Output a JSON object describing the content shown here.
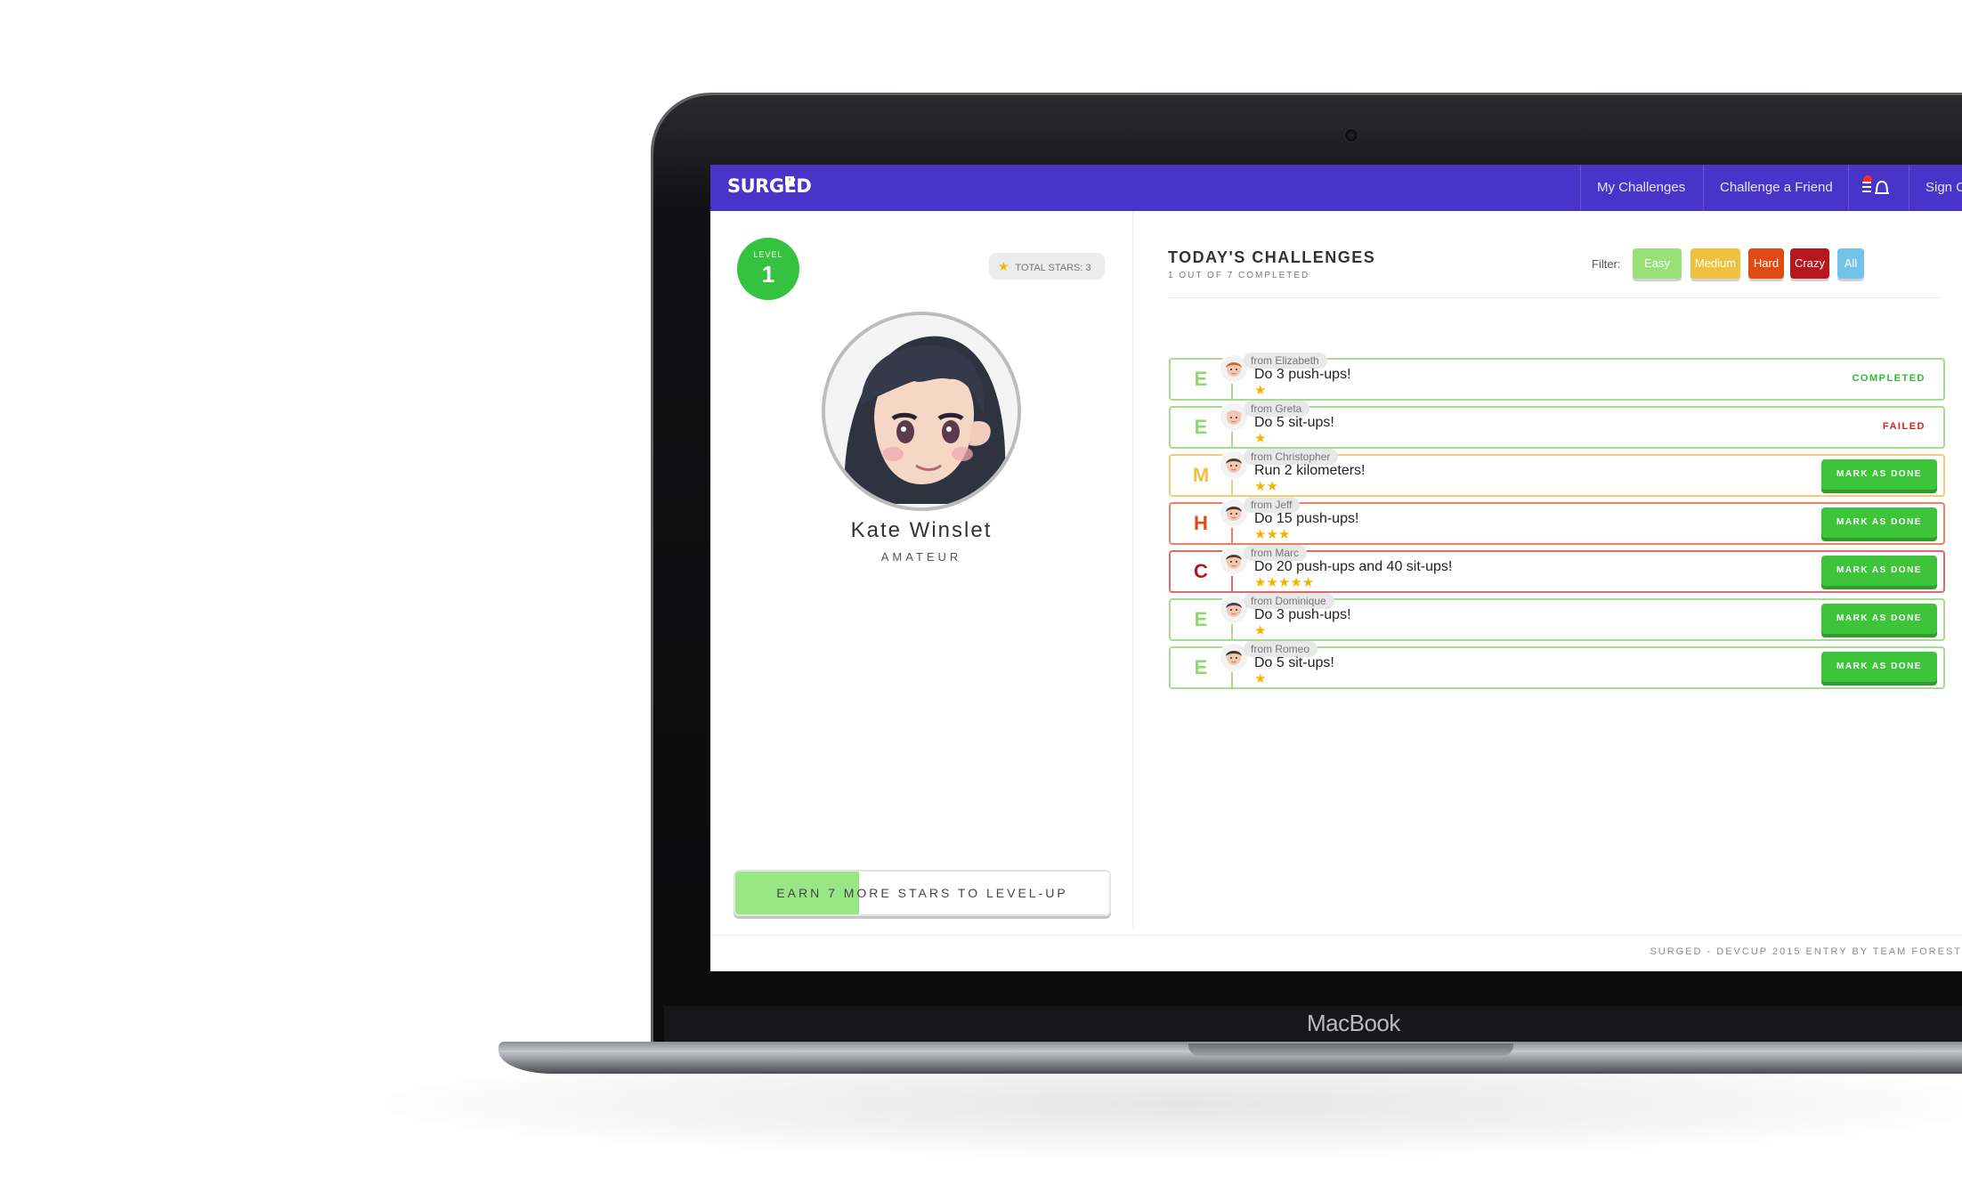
{
  "device": {
    "brand_label": "MacBook"
  },
  "app": {
    "logo_text": "SURGED",
    "logo_badge": "¹",
    "nav": {
      "items": [
        "My Challenges",
        "Challenge a Friend"
      ],
      "sign_out": "Sign O"
    }
  },
  "profile": {
    "level_label": "LEVEL",
    "level_value": "1",
    "stars_label": "TOTAL STARS: 3",
    "name": "Kate Winslet",
    "rank": "AMATEUR",
    "progress_text": "EARN 7 MORE STARS TO LEVEL-UP",
    "progress_fraction": 0.33
  },
  "challenges": {
    "title": "TODAY'S CHALLENGES",
    "subtitle": "1 OUT OF 7 COMPLETED",
    "filter_label": "Filter:",
    "filters": [
      {
        "label": "Easy",
        "color": "#99e077"
      },
      {
        "label": "Medium",
        "color": "#f0c13e"
      },
      {
        "label": "Hard",
        "color": "#e14b13"
      },
      {
        "label": "Crazy",
        "color": "#b7171d"
      },
      {
        "label": "All",
        "color": "#72c2ea"
      }
    ],
    "items": [
      {
        "letter": "E",
        "from": "from Elizabeth",
        "task": "Do 3 push-ups!",
        "stars": "★",
        "status": "COMPLETED",
        "status_color": "#34b734",
        "border_color": "#a6dc8f",
        "letter_color": "#8dda6b"
      },
      {
        "letter": "E",
        "from": "from Greta",
        "task": "Do 5 sit-ups!",
        "stars": "★",
        "status": "FAILED",
        "status_color": "#df1f22",
        "border_color": "#a6dc8f",
        "letter_color": "#8dda6b"
      },
      {
        "letter": "M",
        "from": "from Christopher",
        "task": "Run 2 kilometers!",
        "stars": "★★",
        "status": "MARK AS DONE",
        "status_color": "#3ec43b",
        "border_color": "#f0cd76",
        "letter_color": "#f1c03e"
      },
      {
        "letter": "H",
        "from": "from Jeff",
        "task": "Do 15 push-ups!",
        "stars": "★★★",
        "status": "MARK AS DONE",
        "status_color": "#3ec43b",
        "border_color": "#ef7f62",
        "letter_color": "#e24b17"
      },
      {
        "letter": "C",
        "from": "from Marc",
        "task": "Do 20 push-ups and 40 sit-ups!",
        "stars": "★★★★★",
        "status": "MARK AS DONE",
        "status_color": "#3ec43b",
        "border_color": "#dc6b6b",
        "letter_color": "#b31a1e"
      },
      {
        "letter": "E",
        "from": "from Dominique",
        "task": "Do 3 push-ups!",
        "stars": "★",
        "status": "MARK AS DONE",
        "status_color": "#3ec43b",
        "border_color": "#a6dc8f",
        "letter_color": "#8dda6b"
      },
      {
        "letter": "E",
        "from": "from Romeo",
        "task": "Do 5 sit-ups!",
        "stars": "★",
        "status": "MARK AS DONE",
        "status_color": "#3ec43b",
        "border_color": "#a6dc8f",
        "letter_color": "#8dda6b"
      }
    ]
  },
  "footer": {
    "text": "SURGED - DEVCUP 2015 ENTRY BY TEAM FOREST"
  },
  "colors": {
    "nav_bg": "#4a33c9",
    "accent_green": "#3ec43b"
  }
}
